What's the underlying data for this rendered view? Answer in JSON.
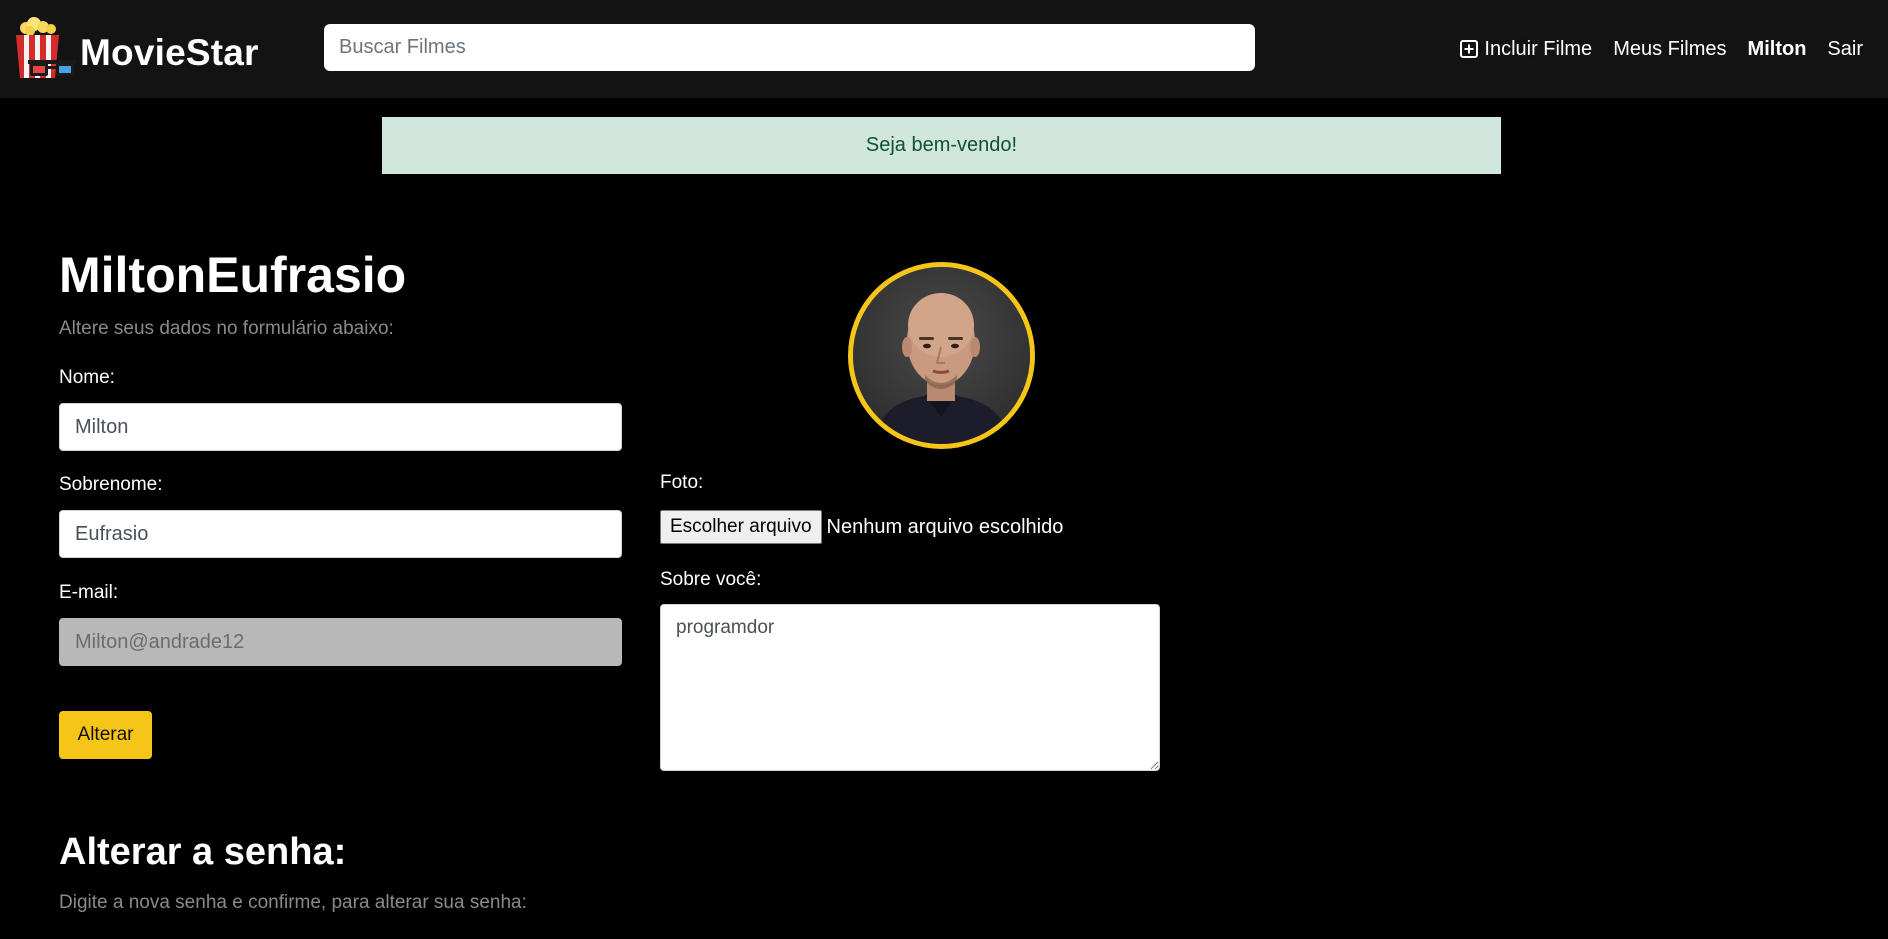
{
  "navbar": {
    "brand": "MovieStar",
    "search_placeholder": "Buscar Filmes",
    "links": {
      "add_movie": "Incluir Filme",
      "my_movies": "Meus Filmes",
      "user": "Milton",
      "logout": "Sair"
    }
  },
  "alert": {
    "message": "Seja bem-vendo!"
  },
  "profile": {
    "title": "MiltonEufrasio",
    "subtitle": "Altere seus dados no formulário abaixo:",
    "name_label": "Nome:",
    "name_value": "Milton",
    "lastname_label": "Sobrenome:",
    "lastname_value": "Eufrasio",
    "email_label": "E-mail:",
    "email_value": "Milton@andrade12",
    "save_button": "Alterar",
    "photo_label": "Foto:",
    "file_button": "Escolher arquivo",
    "file_status": "Nenhum arquivo escolhido",
    "bio_label": "Sobre você:",
    "bio_value": "programdor"
  },
  "password": {
    "title": "Alterar a senha:",
    "subtitle": "Digite a nova senha e confirme, para alterar sua senha:"
  },
  "colors": {
    "accent": "#f5c518",
    "navbar_bg": "#131313",
    "alert_bg": "#d1e7dd",
    "alert_text": "#0f5132"
  }
}
